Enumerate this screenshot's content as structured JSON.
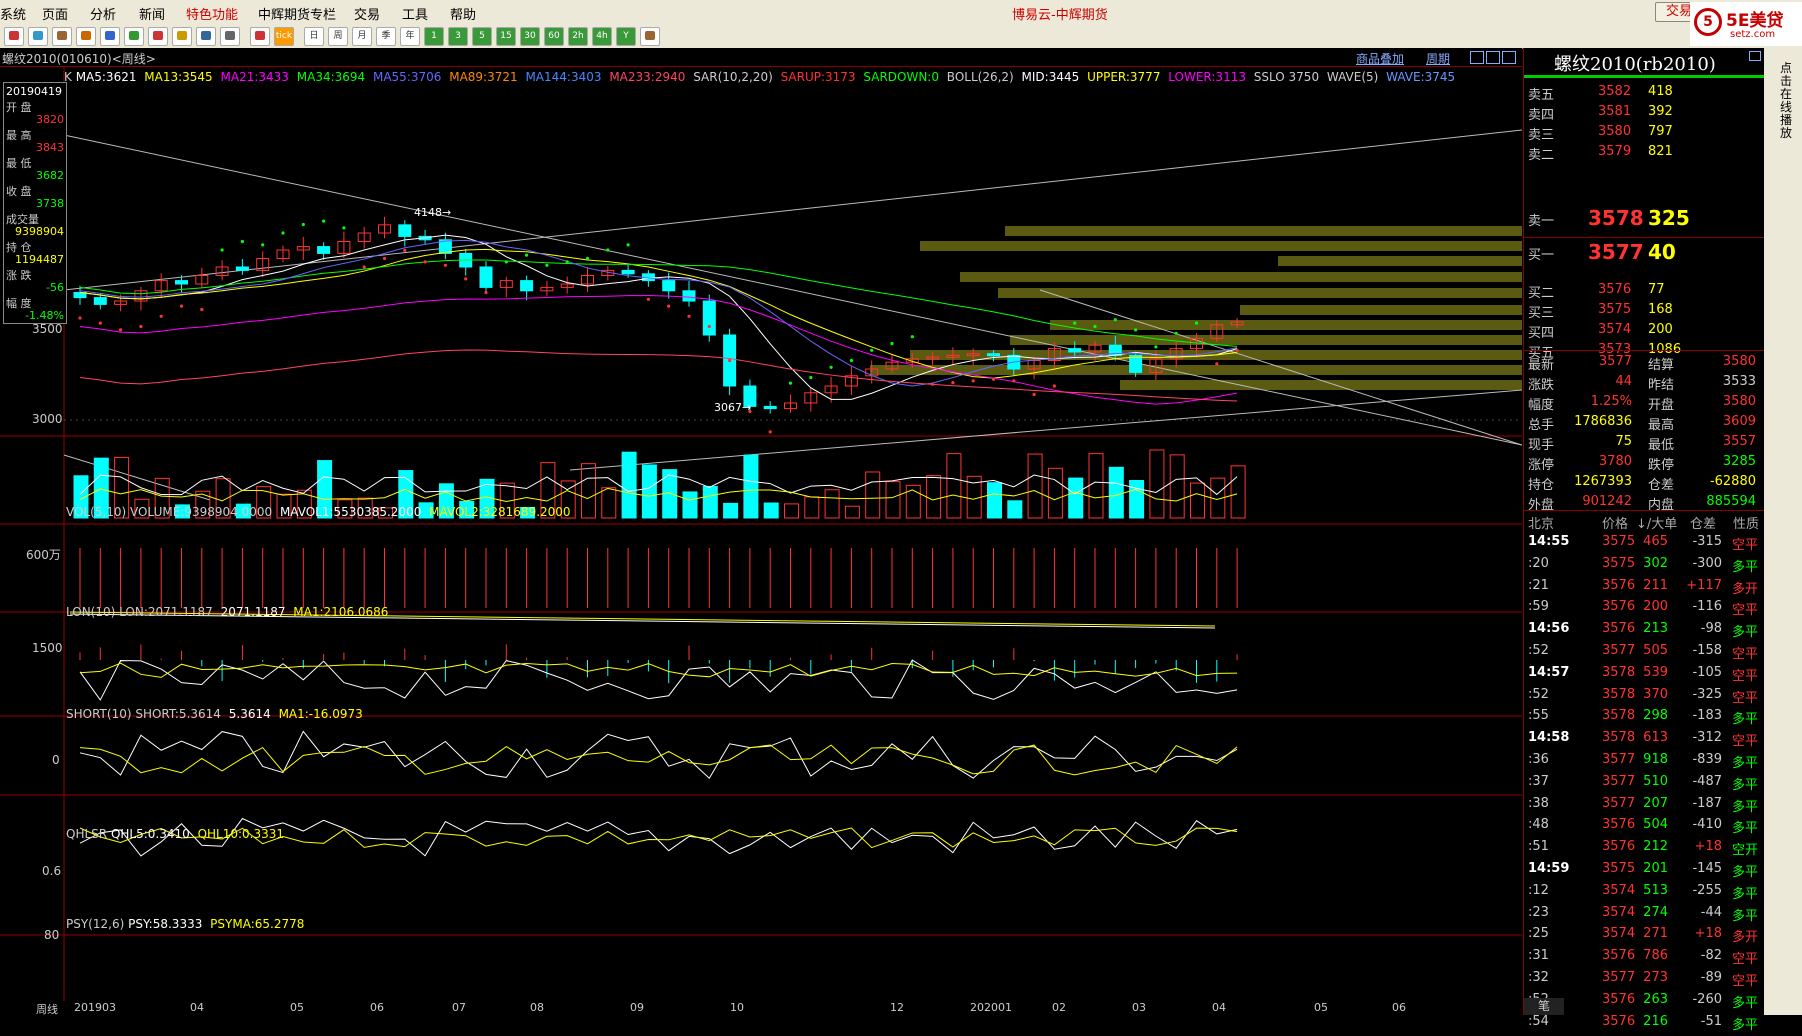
{
  "app": {
    "title": "博易云-中辉期货",
    "menu": [
      "系统",
      "页面",
      "分析",
      "新闻",
      "特色功能",
      "中辉期货专栏",
      "交易",
      "工具",
      "帮助"
    ],
    "trade_button": "交易",
    "logo_text": "5E美贷",
    "logo_url": "setz.com"
  },
  "toolbar": {
    "buttons": [
      "home",
      "folder",
      "list",
      "zoom-in",
      "zoom-out",
      "draw",
      "pen",
      "flag",
      "pin",
      "table",
      "indicator",
      "tick",
      "日",
      "周",
      "月",
      "季",
      "年",
      "1",
      "3",
      "5",
      "15",
      "30",
      "60",
      "2h",
      "4h",
      "Y",
      "sheet"
    ]
  },
  "chart": {
    "symbol_label": "螺纹2010(010610)<周线>",
    "overlay_button": "商品叠加",
    "period_button": "周期",
    "k_prefix": "K",
    "ma_legend": [
      {
        "text": "MA5:3621",
        "color": "#ffffff"
      },
      {
        "text": "MA13:3545",
        "color": "#ffff00"
      },
      {
        "text": "MA21:3433",
        "color": "#ff00ff"
      },
      {
        "text": "MA34:3694",
        "color": "#00ff00"
      },
      {
        "text": "MA55:3706",
        "color": "#6666ff"
      },
      {
        "text": "MA89:3721",
        "color": "#ff8800"
      },
      {
        "text": "MA144:3403",
        "color": "#4488ff"
      },
      {
        "text": "MA233:2940",
        "color": "#ff4466"
      },
      {
        "text": "SAR(10,2,20)",
        "color": "#cccccc"
      },
      {
        "text": "SARUP:3173",
        "color": "#ff3333"
      },
      {
        "text": "SARDOWN:0",
        "color": "#00ff00"
      },
      {
        "text": "BOLL(26,2)",
        "color": "#cccccc"
      },
      {
        "text": "MID:3445",
        "color": "#ffffff"
      },
      {
        "text": "UPPER:3777",
        "color": "#ffff00"
      },
      {
        "text": "LOWER:3113",
        "color": "#ff00ff"
      },
      {
        "text": "SSLO 3750",
        "color": "#cccccc"
      },
      {
        "text": "WAVE(5)",
        "color": "#cccccc"
      },
      {
        "text": "WAVE:3745",
        "color": "#6699ff"
      }
    ],
    "price_axis": [
      "3500",
      "3000"
    ],
    "high_mark": "4148",
    "low_mark": "3067",
    "info_box": {
      "date": "20190419",
      "open_label": "开 盘",
      "open": "3820",
      "high_label": "最 高",
      "high": "3843",
      "low_label": "最 低",
      "low": "3682",
      "close_label": "收 盘",
      "close": "3738",
      "vol_label": "成交量",
      "vol": "9398904",
      "oi_label": "持 仓",
      "oi": "1194487",
      "chg_label": "涨 跌",
      "chg": "-56",
      "pct_label": "幅 度",
      "pct": "-1.48%"
    },
    "vol_panel": {
      "title": "VOL(5,10)",
      "items": [
        {
          "text": "VOLUME:9398904.0000",
          "color": "#cccccc"
        },
        {
          "text": "MAVOL1:5530385.2000",
          "color": "#ffffff"
        },
        {
          "text": "MAVOL2:3281689.2000",
          "color": "#ffff00"
        }
      ],
      "axis": "600万"
    },
    "lon_panel": {
      "title": "LON(10)",
      "items": [
        {
          "text": "LON:2071.1187",
          "color": "#cccccc"
        },
        {
          "text": "2071.1187",
          "color": "#ffffff"
        },
        {
          "text": "MA1:2106.0686",
          "color": "#ffff00"
        }
      ],
      "axis": "1500"
    },
    "short_panel": {
      "title": "SHORT(10)",
      "items": [
        {
          "text": "SHORT:5.3614",
          "color": "#cccccc"
        },
        {
          "text": "5.3614",
          "color": "#ffffff"
        },
        {
          "text": "MA1:-16.0973",
          "color": "#ffff00"
        }
      ],
      "axis": "0"
    },
    "qhlsr_panel": {
      "title": "QHLSR",
      "items": [
        {
          "text": "QHL5:0.3410",
          "color": "#ffffff"
        },
        {
          "text": "QHL10:0.3331",
          "color": "#ffff00"
        }
      ],
      "axis": "0.6"
    },
    "psy_panel": {
      "title": "PSY(12,6)",
      "items": [
        {
          "text": "PSY:58.3333",
          "color": "#ffffff"
        },
        {
          "text": "PSYMA:65.2778",
          "color": "#ffff00"
        }
      ],
      "axis": "80"
    },
    "period_tab": "周线",
    "date_axis": [
      "201903",
      "04",
      "05",
      "06",
      "07",
      "08",
      "09",
      "10",
      "12",
      "202001",
      "02",
      "03",
      "04",
      "05",
      "06"
    ]
  },
  "quote": {
    "title": "螺纹2010(rb2010)",
    "asks": [
      {
        "label": "卖五",
        "price": "3582",
        "vol": "418"
      },
      {
        "label": "卖四",
        "price": "3581",
        "vol": "392"
      },
      {
        "label": "卖三",
        "price": "3580",
        "vol": "797"
      },
      {
        "label": "卖二",
        "price": "3579",
        "vol": "821"
      },
      {
        "label": "卖一",
        "price": "3578",
        "vol": "325"
      }
    ],
    "bids": [
      {
        "label": "买一",
        "price": "3577",
        "vol": "40"
      },
      {
        "label": "买二",
        "price": "3576",
        "vol": "77"
      },
      {
        "label": "买三",
        "price": "3575",
        "vol": "168"
      },
      {
        "label": "买四",
        "price": "3574",
        "vol": "200"
      },
      {
        "label": "买五",
        "price": "3573",
        "vol": "1086"
      }
    ],
    "stats": [
      {
        "l1": "最新",
        "v1": "3577",
        "c1": "#ff3333",
        "l2": "结算",
        "v2": "3580",
        "c2": "#ff3333"
      },
      {
        "l1": "涨跌",
        "v1": "44",
        "c1": "#ff3333",
        "l2": "昨结",
        "v2": "3533",
        "c2": "#cccccc"
      },
      {
        "l1": "幅度",
        "v1": "1.25%",
        "c1": "#ff3333",
        "l2": "开盘",
        "v2": "3580",
        "c2": "#ff3333"
      },
      {
        "l1": "总手",
        "v1": "1786836",
        "c1": "#ffff00",
        "l2": "最高",
        "v2": "3609",
        "c2": "#ff3333"
      },
      {
        "l1": "现手",
        "v1": "75",
        "c1": "#ffff00",
        "l2": "最低",
        "v2": "3557",
        "c2": "#ff3333"
      },
      {
        "l1": "涨停",
        "v1": "3780",
        "c1": "#ff3333",
        "l2": "跌停",
        "v2": "3285",
        "c2": "#00ff00"
      },
      {
        "l1": "持仓",
        "v1": "1267393",
        "c1": "#ffff00",
        "l2": "仓差",
        "v2": "-62880",
        "c2": "#ffff00"
      },
      {
        "l1": "外盘",
        "v1": "901242",
        "c1": "#ff3333",
        "l2": "内盘",
        "v2": "885594",
        "c2": "#00ff00"
      }
    ],
    "ticks_header": {
      "time": "北京",
      "price": "价格",
      "vol": "↓/大单",
      "oi": "仓差",
      "nature": "性质"
    },
    "ticks": [
      {
        "time": "14:55",
        "price": "3575",
        "vol": "465",
        "vc": "#ff3333",
        "oi": "-315",
        "nature": "空平",
        "nc": "#ff3333"
      },
      {
        "time": ":20",
        "price": "3575",
        "vol": "302",
        "vc": "#00ff00",
        "oi": "-300",
        "nature": "多平",
        "nc": "#00ff00"
      },
      {
        "time": ":21",
        "price": "3576",
        "vol": "211",
        "vc": "#ff3333",
        "oi": "+117",
        "nature": "多开",
        "nc": "#ff3333"
      },
      {
        "time": ":59",
        "price": "3576",
        "vol": "200",
        "vc": "#ff3333",
        "oi": "-116",
        "nature": "空平",
        "nc": "#ff3333"
      },
      {
        "time": "14:56",
        "price": "3576",
        "vol": "213",
        "vc": "#00ff00",
        "oi": "-98",
        "nature": "多平",
        "nc": "#00ff00"
      },
      {
        "time": ":52",
        "price": "3577",
        "vol": "505",
        "vc": "#ff3333",
        "oi": "-158",
        "nature": "空平",
        "nc": "#ff3333"
      },
      {
        "time": "14:57",
        "price": "3578",
        "vol": "539",
        "vc": "#ff3333",
        "oi": "-105",
        "nature": "空平",
        "nc": "#ff3333"
      },
      {
        "time": ":52",
        "price": "3578",
        "vol": "370",
        "vc": "#ff3333",
        "oi": "-325",
        "nature": "空平",
        "nc": "#ff3333"
      },
      {
        "time": ":55",
        "price": "3578",
        "vol": "298",
        "vc": "#00ff00",
        "oi": "-183",
        "nature": "多平",
        "nc": "#00ff00"
      },
      {
        "time": "14:58",
        "price": "3578",
        "vol": "613",
        "vc": "#ff3333",
        "oi": "-312",
        "nature": "空平",
        "nc": "#ff3333"
      },
      {
        "time": ":36",
        "price": "3577",
        "vol": "918",
        "vc": "#00ff00",
        "oi": "-839",
        "nature": "多平",
        "nc": "#00ff00"
      },
      {
        "time": ":37",
        "price": "3577",
        "vol": "510",
        "vc": "#00ff00",
        "oi": "-487",
        "nature": "多平",
        "nc": "#00ff00"
      },
      {
        "time": ":38",
        "price": "3577",
        "vol": "207",
        "vc": "#00ff00",
        "oi": "-187",
        "nature": "多平",
        "nc": "#00ff00"
      },
      {
        "time": ":48",
        "price": "3576",
        "vol": "504",
        "vc": "#00ff00",
        "oi": "-410",
        "nature": "多平",
        "nc": "#00ff00"
      },
      {
        "time": ":51",
        "price": "3576",
        "vol": "212",
        "vc": "#00ff00",
        "oi": "+18",
        "nature": "空开",
        "nc": "#00ff00"
      },
      {
        "time": "14:59",
        "price": "3575",
        "vol": "201",
        "vc": "#00ff00",
        "oi": "-145",
        "nature": "多平",
        "nc": "#00ff00"
      },
      {
        "time": ":12",
        "price": "3574",
        "vol": "513",
        "vc": "#00ff00",
        "oi": "-255",
        "nature": "多平",
        "nc": "#00ff00"
      },
      {
        "time": ":23",
        "price": "3574",
        "vol": "274",
        "vc": "#00ff00",
        "oi": "-44",
        "nature": "多平",
        "nc": "#00ff00"
      },
      {
        "time": ":25",
        "price": "3574",
        "vol": "271",
        "vc": "#ff3333",
        "oi": "+18",
        "nature": "多开",
        "nc": "#ff3333"
      },
      {
        "time": ":31",
        "price": "3576",
        "vol": "786",
        "vc": "#ff3333",
        "oi": "-82",
        "nature": "空平",
        "nc": "#ff3333"
      },
      {
        "time": ":32",
        "price": "3577",
        "vol": "273",
        "vc": "#ff3333",
        "oi": "-89",
        "nature": "空平",
        "nc": "#ff3333"
      },
      {
        "time": ":52",
        "price": "3576",
        "vol": "263",
        "vc": "#00ff00",
        "oi": "-260",
        "nature": "多平",
        "nc": "#00ff00"
      },
      {
        "time": ":54",
        "price": "3576",
        "vol": "216",
        "vc": "#00ff00",
        "oi": "-51",
        "nature": "多平",
        "nc": "#00ff00"
      }
    ],
    "bottom_tab": "笔",
    "side_text": "点击在线播放"
  }
}
